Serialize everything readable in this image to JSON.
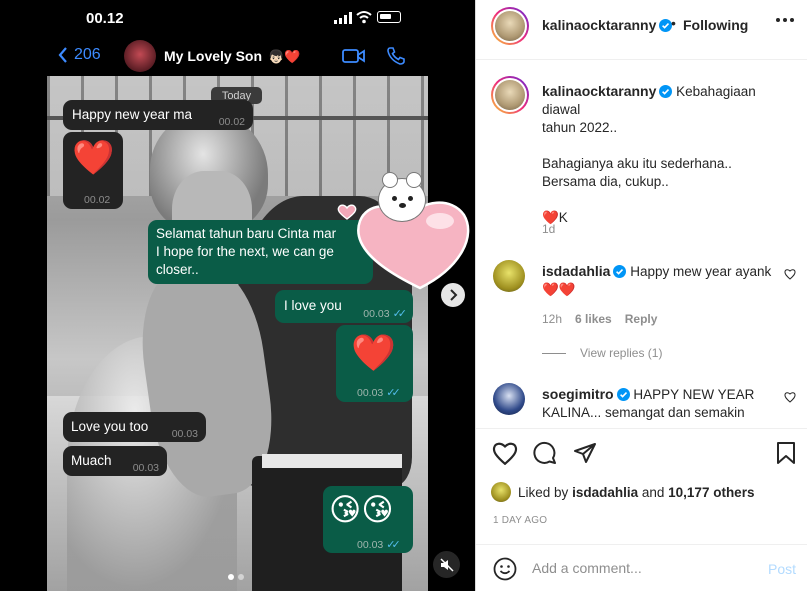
{
  "phone": {
    "time": "00.12",
    "chat_back_count": "206",
    "chat_title": "My Lovely Son",
    "chat_title_emojis": "👦🏻❤️"
  },
  "chat": {
    "date_chip": "Today",
    "messages": [
      {
        "text": "Happy new year ma",
        "time": "00.02",
        "side": "in"
      },
      {
        "text": "❤️",
        "time": "00.02",
        "side": "in"
      },
      {
        "text": "Selamat tahun baru Cinta mar",
        "text2": "I hope for the next, we can ge",
        "text3": "closer..",
        "side": "out"
      },
      {
        "text": "I love you",
        "time": "00.03",
        "side": "out"
      },
      {
        "text": "❤️",
        "time": "00.03",
        "side": "out"
      },
      {
        "text": "Love you too",
        "time": "00.03",
        "side": "in"
      },
      {
        "text": "Muach",
        "time": "00.03",
        "side": "in"
      },
      {
        "text": "😘😘",
        "time": "00.03",
        "side": "out"
      }
    ],
    "carousel_index": 1,
    "carousel_count": 2
  },
  "post": {
    "username": "kalinaocktaranny",
    "follow_state": "Following",
    "caption_lines": [
      "Kebahagiaan diawal",
      "tahun 2022..",
      "",
      "Bahagianya aku itu sederhana..",
      "Bersama dia, cukup..",
      "",
      "❤️K"
    ],
    "caption_time": "1d"
  },
  "comments": [
    {
      "user": "isdadahlia",
      "text": "Happy mew year ayank ❤️❤️",
      "time": "12h",
      "likes": "6 likes",
      "reply": "Reply",
      "view_replies": "View replies (1)"
    },
    {
      "user": "soegimitro",
      "text": "HAPPY NEW YEAR KALINA... semangat dan semakin"
    }
  ],
  "likes": {
    "prefix": "Liked by",
    "user": "isdadahlia",
    "and": "and",
    "count": "10,177 others"
  },
  "posted_ago": "1 DAY AGO",
  "add_comment": {
    "placeholder": "Add a comment...",
    "post_label": "Post"
  },
  "colors": {
    "link_blue": "#3d8bff",
    "outgoing_bubble": "#0a5c47",
    "incoming_bubble": "#232323",
    "verified_blue": "#0095f6",
    "post_button_disabled": "#b3dbff"
  }
}
